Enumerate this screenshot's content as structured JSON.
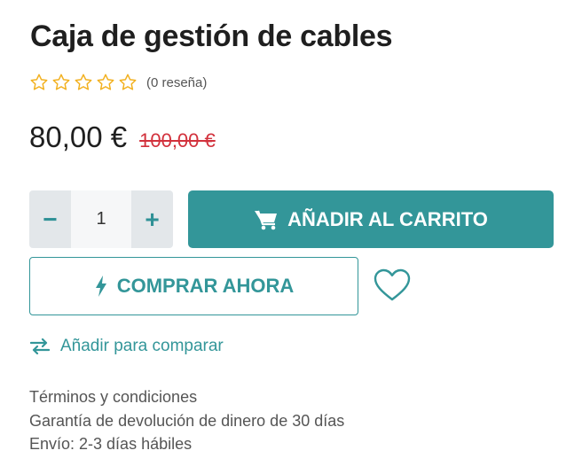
{
  "product": {
    "title": "Caja de gestión de cables",
    "rating": {
      "stars": 0,
      "max_stars": 5,
      "review_count_label": "(0 reseña)"
    },
    "price_current": "80,00 €",
    "price_old": "100,00 €"
  },
  "cart": {
    "quantity": "1",
    "decrement_label": "−",
    "increment_label": "+",
    "add_to_cart_label": "AÑADIR AL CARRITO",
    "buy_now_label": "COMPRAR AHORA",
    "wishlist_icon": "heart-icon"
  },
  "compare": {
    "label": "Añadir para comparar",
    "icon": "swap-arrows-icon"
  },
  "info": {
    "lines": [
      "Términos y condiciones",
      "Garantía de devolución de dinero de 30 días",
      "Envío: 2-3 días hábiles"
    ]
  },
  "colors": {
    "accent": "#339699",
    "star": "#f2b01e",
    "old_price": "#d2313c",
    "qty_button_bg": "#e3e7ea"
  }
}
